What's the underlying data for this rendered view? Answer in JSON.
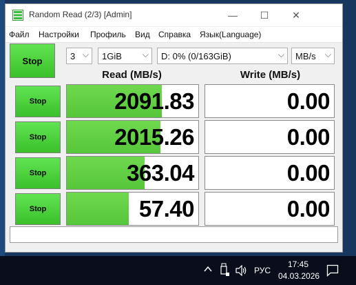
{
  "window": {
    "title": "Random Read (2/3) [Admin]",
    "controls": {
      "minimize": "—",
      "maximize": "☐",
      "close": "✕"
    }
  },
  "menu": [
    "Файл",
    "Настройки",
    "Профиль",
    "Вид",
    "Справка",
    "Язык(Language)"
  ],
  "toolbar": {
    "all_button": "Stop",
    "count": "3",
    "size": "1GiB",
    "drive": "D: 0% (0/163GiB)",
    "unit": "MB/s"
  },
  "columns": {
    "read": "Read (MB/s)",
    "write": "Write (MB/s)"
  },
  "rows": [
    {
      "button": "Stop",
      "read": "2091.83",
      "write": "0.00",
      "read_fraction": 0.72,
      "write_fraction": 0
    },
    {
      "button": "Stop",
      "read": "2015.26",
      "write": "0.00",
      "read_fraction": 0.71,
      "write_fraction": 0
    },
    {
      "button": "Stop",
      "read": "363.04",
      "write": "0.00",
      "read_fraction": 0.59,
      "write_fraction": 0
    },
    {
      "button": "Stop",
      "read": "57.40",
      "write": "0.00",
      "read_fraction": 0.47,
      "write_fraction": 0
    }
  ],
  "status": "",
  "taskbar": {
    "language": "РУС",
    "time": "17:45",
    "date": "04.03.2026"
  },
  "colors": {
    "button_green": "#39c02a",
    "bar_green": "#56c63a",
    "taskbar": "#0a0e1c"
  }
}
